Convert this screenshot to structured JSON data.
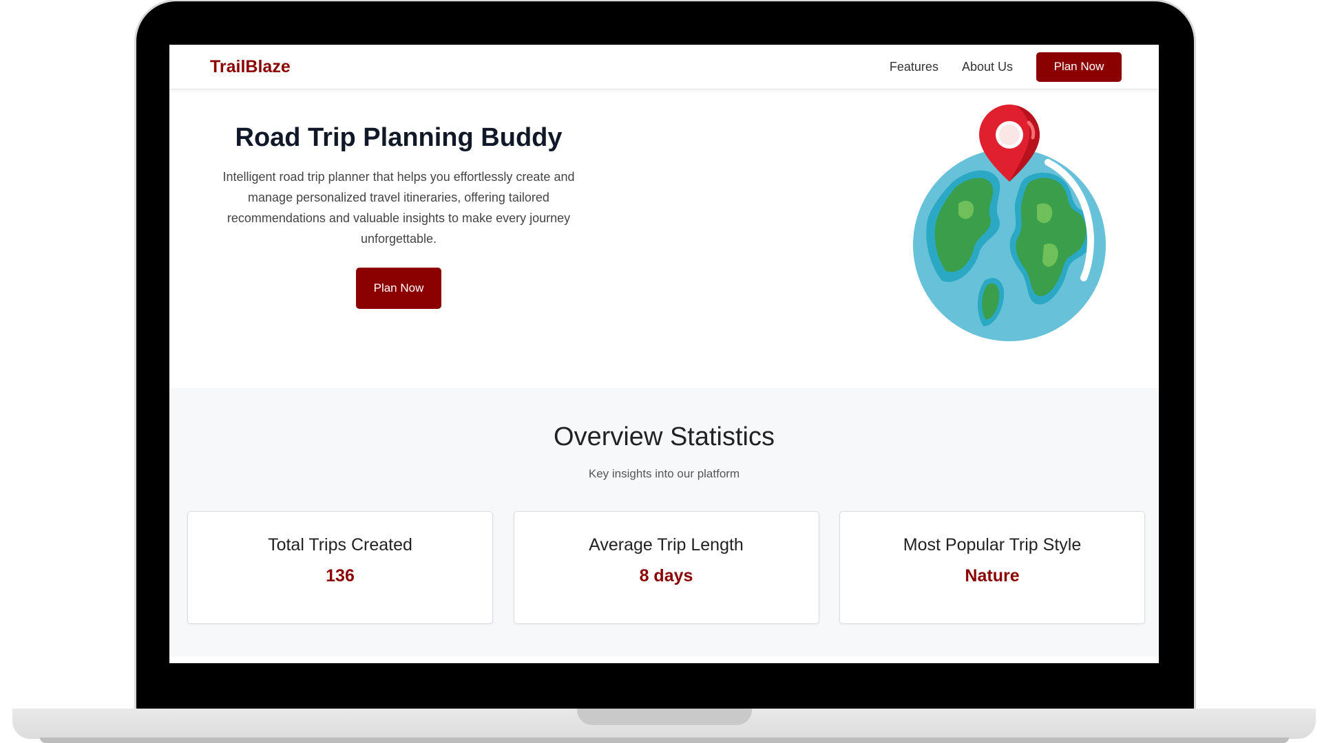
{
  "navbar": {
    "brand": "TrailBlaze",
    "links": [
      "Features",
      "About Us"
    ],
    "cta_label": "Plan Now"
  },
  "hero": {
    "title": "Road Trip Planning Buddy",
    "description": "Intelligent road trip planner that helps you effortlessly create and manage personalized travel itineraries, offering tailored recommendations and valuable insights to make every journey unforgettable.",
    "cta_label": "Plan Now",
    "illustration": "globe-with-map-pin"
  },
  "stats": {
    "title": "Overview Statistics",
    "subtitle": "Key insights into our platform",
    "cards": [
      {
        "label": "Total Trips Created",
        "value": "136"
      },
      {
        "label": "Average Trip Length",
        "value": "8 days"
      },
      {
        "label": "Most Popular Trip Style",
        "value": "Nature"
      }
    ]
  },
  "colors": {
    "brand": "#8b0000",
    "stats_background": "#f7f8fa"
  }
}
